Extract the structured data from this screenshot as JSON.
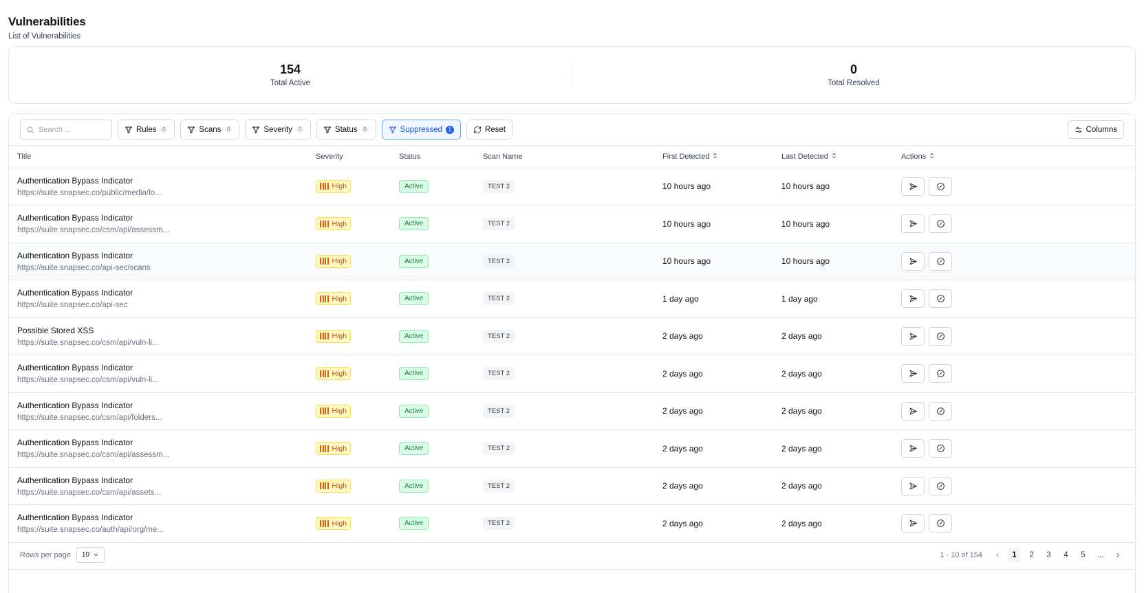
{
  "header": {
    "title": "Vulnerabilities",
    "subtitle": "List of Vulnerabilities"
  },
  "stats": {
    "total_active": {
      "value": "154",
      "label": "Total Active"
    },
    "total_resolved": {
      "value": "0",
      "label": "Total Resolved"
    }
  },
  "toolbar": {
    "search_placeholder": "Search ...",
    "filters": [
      {
        "label": "Rules",
        "count": "0",
        "active": false
      },
      {
        "label": "Scans",
        "count": "0",
        "active": false
      },
      {
        "label": "Severity",
        "count": "0",
        "active": false
      },
      {
        "label": "Status",
        "count": "0",
        "active": false
      },
      {
        "label": "Suppressed",
        "count": "1",
        "active": true
      }
    ],
    "reset_label": "Reset",
    "columns_label": "Columns"
  },
  "table": {
    "columns": [
      "Title",
      "Severity",
      "Status",
      "Scan Name",
      "First Detected",
      "Last Detected",
      "Actions"
    ],
    "rows": [
      {
        "title": "Authentication Bypass Indicator",
        "url": "https://suite.snapsec.co/public/media/lo...",
        "severity": "High",
        "status": "Active",
        "scan": "TEST 2",
        "first": "10 hours ago",
        "last": "10 hours ago"
      },
      {
        "title": "Authentication Bypass Indicator",
        "url": "https://suite.snapsec.co/csm/api/assessm...",
        "severity": "High",
        "status": "Active",
        "scan": "TEST 2",
        "first": "10 hours ago",
        "last": "10 hours ago"
      },
      {
        "title": "Authentication Bypass Indicator",
        "url": "https://suite.snapsec.co/api-sec/scans",
        "severity": "High",
        "status": "Active",
        "scan": "TEST 2",
        "first": "10 hours ago",
        "last": "10 hours ago"
      },
      {
        "title": "Authentication Bypass Indicator",
        "url": "https://suite.snapsec.co/api-sec",
        "severity": "High",
        "status": "Active",
        "scan": "TEST 2",
        "first": "1 day ago",
        "last": "1 day ago"
      },
      {
        "title": "Possible Stored XSS",
        "url": "https://suite.snapsec.co/csm/api/vuln-li...",
        "severity": "High",
        "status": "Active",
        "scan": "TEST 2",
        "first": "2 days ago",
        "last": "2 days ago"
      },
      {
        "title": "Authentication Bypass Indicator",
        "url": "https://suite.snapsec.co/csm/api/vuln-li...",
        "severity": "High",
        "status": "Active",
        "scan": "TEST 2",
        "first": "2 days ago",
        "last": "2 days ago"
      },
      {
        "title": "Authentication Bypass Indicator",
        "url": "https://suite.snapsec.co/csm/api/folders...",
        "severity": "High",
        "status": "Active",
        "scan": "TEST 2",
        "first": "2 days ago",
        "last": "2 days ago"
      },
      {
        "title": "Authentication Bypass Indicator",
        "url": "https://suite.snapsec.co/csm/api/assessm...",
        "severity": "High",
        "status": "Active",
        "scan": "TEST 2",
        "first": "2 days ago",
        "last": "2 days ago"
      },
      {
        "title": "Authentication Bypass Indicator",
        "url": "https://suite.snapsec.co/csm/api/assets...",
        "severity": "High",
        "status": "Active",
        "scan": "TEST 2",
        "first": "2 days ago",
        "last": "2 days ago"
      },
      {
        "title": "Authentication Bypass Indicator",
        "url": "https://suite.snapsec.co/auth/api/org/me...",
        "severity": "High",
        "status": "Active",
        "scan": "TEST 2",
        "first": "2 days ago",
        "last": "2 days ago"
      }
    ]
  },
  "pagination": {
    "rows_per_page_label": "Rows per page",
    "rows_per_page_value": "10",
    "range_text": "1 - 10 of 154",
    "pages": [
      "1",
      "2",
      "3",
      "4",
      "5",
      "..."
    ],
    "current_page": "1"
  },
  "colors": {
    "severity_high_bar": "#ea580c",
    "status_active": "#15803d",
    "accent": "#2563eb"
  }
}
